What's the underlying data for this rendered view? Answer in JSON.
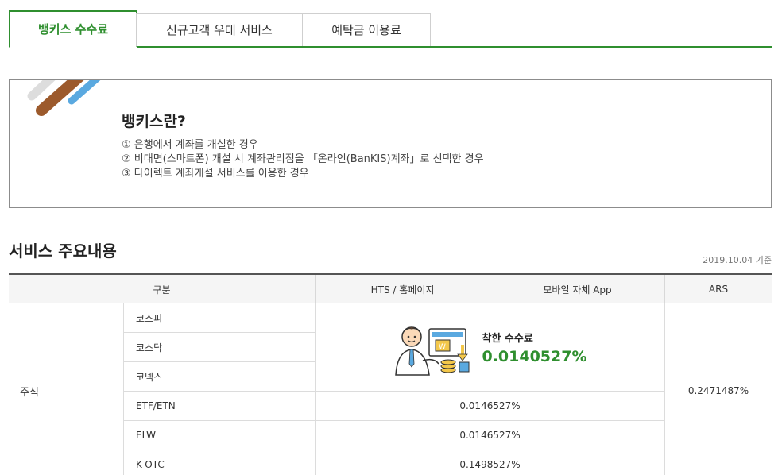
{
  "tabs": [
    {
      "label": "뱅키스 수수료",
      "active": true
    },
    {
      "label": "신규고객 우대 서비스",
      "active": false
    },
    {
      "label": "예탁금 이용료",
      "active": false
    }
  ],
  "info": {
    "title": "뱅키스란?",
    "items": [
      "① 은행에서 계좌를 개설한 경우",
      "② 비대면(스마트폰) 개설 시 계좌관리점을 「온라인(BanKIS)계좌」로 선택한 경우",
      "③ 다이렉트 계좌개설 서비스를 이용한 경우"
    ]
  },
  "section": {
    "title": "서비스 주요내용",
    "base_date": "2019.10.04 기준"
  },
  "table": {
    "headers": [
      "구분",
      "HTS / 홈페이지",
      "모바일 자체 App",
      "ARS"
    ],
    "category": "주식",
    "subrows": [
      "코스피",
      "코스닥",
      "코넥스",
      "ETF/ETN",
      "ELW",
      "K-OTC"
    ],
    "promo": {
      "label": "착한 수수료",
      "rate": "0.0140527%"
    },
    "values": [
      "0.0146527%",
      "0.0146527%",
      "0.1498527%"
    ],
    "ars": "0.2471487%"
  },
  "colors": {
    "accent": "#2f8f2f",
    "deco_brown": "#9c5a2c",
    "deco_blue": "#5aa9e0",
    "deco_gray": "#dddddd"
  }
}
